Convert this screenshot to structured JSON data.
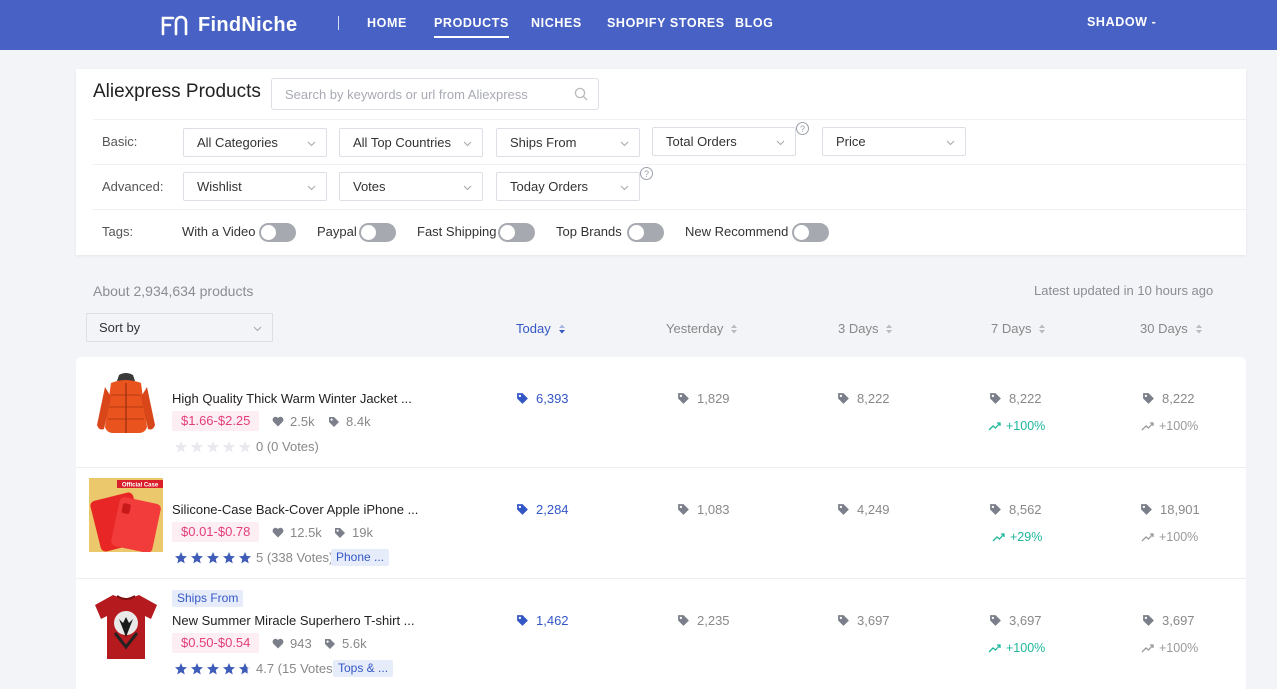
{
  "brand": {
    "name": "FindNiche"
  },
  "nav": [
    {
      "label": "HOME"
    },
    {
      "label": "PRODUCTS",
      "active": true
    },
    {
      "label": "NICHES"
    },
    {
      "label": "SHOPIFY STORES"
    },
    {
      "label": "BLOG"
    }
  ],
  "user": {
    "label": "SHADOW -"
  },
  "page": {
    "title": "Aliexpress Products",
    "search_placeholder": "Search by keywords or url from Aliexpress"
  },
  "filters": {
    "basic_label": "Basic:",
    "advanced_label": "Advanced:",
    "tags_label": "Tags:",
    "basic": [
      "All Categories",
      "All Top Countries",
      "Ships From",
      "Total Orders",
      "Price"
    ],
    "advanced": [
      "Wishlist",
      "Votes",
      "Today Orders"
    ],
    "help_glyph": "?",
    "tags": [
      "With a Video",
      "Paypal",
      "Fast Shipping",
      "Top Brands",
      "New Recommend"
    ]
  },
  "results": {
    "count": "About 2,934,634 products",
    "updated": "Latest updated in 10 hours ago",
    "sort_label": "Sort by",
    "columns": [
      "Today",
      "Yesterday",
      "3 Days",
      "7 Days",
      "30 Days"
    ]
  },
  "products": [
    {
      "title": "High Quality Thick Warm Winter Jacket ...",
      "price": "$1.66-$2.25",
      "wishlist": "2.5k",
      "orders": "8.4k",
      "rating_text": "0 (0 Votes)",
      "rating": 0,
      "category": "",
      "ships_from": "",
      "today": "6,393",
      "yesterday": "1,829",
      "days3": "8,222",
      "days7": "8,222",
      "days7_trend": "+100%",
      "days30": "8,222",
      "days30_trend": "+100%"
    },
    {
      "title": "Silicone-Case Back-Cover Apple iPhone ...",
      "price": "$0.01-$0.78",
      "wishlist": "12.5k",
      "orders": "19k",
      "rating_text": "5 (338 Votes)",
      "rating": 5,
      "category": "Phone ...",
      "thumb_caption": "Official Case",
      "ships_from": "",
      "today": "2,284",
      "yesterday": "1,083",
      "days3": "4,249",
      "days7": "8,562",
      "days7_trend": "+29%",
      "days30": "18,901",
      "days30_trend": "+100%"
    },
    {
      "title": "New Summer Miracle Superhero T-shirt ...",
      "price": "$0.50-$0.54",
      "wishlist": "943",
      "orders": "5.6k",
      "rating_text": "4.7 (15 Votes)",
      "rating": 4.7,
      "category": "Tops & ...",
      "ships_from": "Ships From",
      "today": "1,462",
      "yesterday": "2,235",
      "days3": "3,697",
      "days7": "3,697",
      "days7_trend": "+100%",
      "days30": "3,697",
      "days30_trend": "+100%"
    }
  ],
  "colors": {
    "header": "#4762c4",
    "accent": "#3457c6",
    "price": "#e23d7b",
    "trend_up": "#1fb69a"
  }
}
